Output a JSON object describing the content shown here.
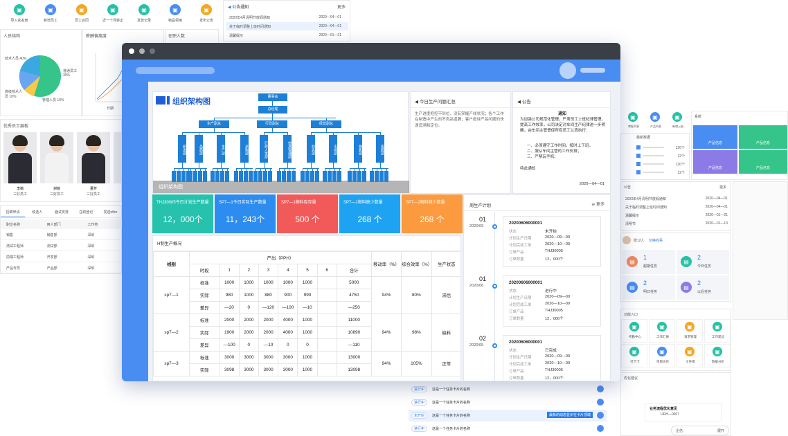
{
  "bg_top_left": {
    "quick_actions": [
      {
        "label": "导入花名册",
        "color": "#26c2a4",
        "icon": "import-icon"
      },
      {
        "label": "新增员工",
        "color": "#4a8df2",
        "icon": "add-user-icon"
      },
      {
        "label": "员工合同",
        "color": "#f5a623",
        "icon": "contract-icon"
      },
      {
        "label": "近一个月转正",
        "color": "#26c2a4",
        "icon": "calendar-icon"
      },
      {
        "label": "发放记录",
        "color": "#26c2a4",
        "icon": "record-icon"
      },
      {
        "label": "物品领用",
        "color": "#4a8df2",
        "icon": "box-icon"
      },
      {
        "label": "发布公告",
        "color": "#f5a623",
        "icon": "announce-icon"
      }
    ],
    "structure_title": "人员结构",
    "pie_labels": [
      "技术人员 40%",
      "普通员工 30%",
      "高级技术人员 10%",
      "管理人员 10%"
    ],
    "salary_title": "薪酬偏离度",
    "line_x_label": "日期",
    "headcount_title": "在职人数",
    "excellent_title": "优秀员工展板",
    "employees": [
      {
        "name": "李萌",
        "role": "三好员工"
      },
      {
        "name": "谢敏",
        "role": "三好员工"
      },
      {
        "name": "董芳",
        "role": "三好员工"
      }
    ],
    "tabs": [
      "招聘申请",
      "候选人",
      "面试安排",
      "在职登记",
      "发送offer"
    ],
    "table_headers": [
      "职位名称",
      "用人部门",
      "工作地"
    ],
    "table_rows": [
      [
        "销售",
        "销售部",
        "深圳"
      ],
      [
        "测试工程师",
        "测试部",
        "深圳"
      ],
      [
        "前端工程师",
        "开发部",
        "深圳"
      ],
      [
        "产品专员",
        "产品部",
        "深圳"
      ]
    ],
    "notice_title": "公告通知",
    "notice_more": "更多",
    "notices": [
      {
        "title": "2020年4月清明节放假通知",
        "date": "2020—04—01"
      },
      {
        "title": "关于临时调整上班时间通知",
        "date": "2020—04—01"
      },
      {
        "title": "温馨提示",
        "date": "2020—01—21"
      }
    ]
  },
  "bg_right": {
    "quick_icons": [
      "审批列表",
      "产品列表",
      "新增上报"
    ],
    "list_title": "最新数据",
    "list_values": [
      "120个",
      "12个",
      "120个",
      "12个"
    ],
    "sys_title": "系统",
    "tiles": [
      "产品信息",
      "产品信息",
      "产品信息",
      "产品信息"
    ],
    "notice_title": "公告",
    "notice_more": "更多",
    "notices": [
      {
        "title": "2020年4月清明节放假通知",
        "date": "2020—04—01"
      },
      {
        "title": "关于临时调整上班时间通知",
        "date": "2020—04—01"
      },
      {
        "title": "温馨提示",
        "date": "2020—01—21"
      },
      {
        "title": "清明节",
        "date": "2020—01—13"
      }
    ],
    "greeting": "张12人",
    "switch_label": "切换商事",
    "tasks": [
      {
        "count": "1",
        "label": "超期任务",
        "color": "#f08a5d"
      },
      {
        "count": "2",
        "label": "今日任务",
        "color": "#26c2a4"
      },
      {
        "count": "2",
        "label": "明日任务",
        "color": "#4a8df2"
      },
      {
        "count": "2",
        "label": "以后任务",
        "color": "#8c7ae6"
      }
    ],
    "entry_title": "功能入口",
    "entries": [
      {
        "label": "考勤中心",
        "color": "#26c2a4"
      },
      {
        "label": "工作汇报",
        "color": "#26c2a4"
      },
      {
        "label": "请求管理",
        "color": "#f5a623"
      },
      {
        "label": "工作建议",
        "color": "#26c2a4"
      },
      {
        "label": "打卡卡",
        "color": "#26c2a4"
      },
      {
        "label": "项目协作",
        "color": "#4a8df2"
      },
      {
        "label": "文件库",
        "color": "#f5a623"
      },
      {
        "label": "数据分析",
        "color": "#26c2a4"
      }
    ],
    "suggest_title": "优化建议",
    "suggest_card_title": "业务流程优化意见",
    "suggest_card_id": "URH—0067",
    "float_btn_left": "企信",
    "float_btn_right": "展开"
  },
  "bg_bottom_tasks": [
    {
      "status": "进行中",
      "text": "这是一个任务卡片的名称"
    },
    {
      "status": "进行中",
      "text": "这是一个任务卡片的名称"
    },
    {
      "status": "未开始",
      "text": "这是一个任务卡片的名称",
      "tag": "最新的动态显示在卡片顶端"
    },
    {
      "status": "进行中",
      "text": "这是一个任务卡片的名称"
    }
  ],
  "main": {
    "org_title": "组织架构图",
    "org_caption": "组织架构图",
    "org_top": [
      "董事会",
      "总经理"
    ],
    "org_mid": [
      "生产副总",
      "行政副总",
      "经营副总"
    ],
    "org_depts": [
      "研发部",
      "品质部",
      "生产部",
      "采购部",
      "行政人事部",
      "信息管理部",
      "财务部",
      "市场部",
      "销售部",
      "客服部"
    ],
    "issue_title": "今日生产问题汇总",
    "issue_text": "生产进度把控不到位，没有掌握产线状况；各个工作在制造中产生的不良品遗漏；客户投诉产品问题的快速追溯和定位。",
    "notice_title": "公告",
    "notice_heading": "通知",
    "notice_body": "为加强公司规范化管理，严肃员工上班纪律管理，提高工作效率，公司决定对车间生产纪律进一步明确，由车间主管督促所有员工认真执行：",
    "notice_items": [
      "一、必须遵守工作时间，按时上下班。",
      "二、服从车间主管的工作安排；",
      "三、严禁玩手机；"
    ],
    "notice_footer": "特此通知",
    "notice_date": "2020—04—01",
    "kpis": [
      {
        "title": "THJ30005今日计划生产数量",
        "value": "12，000个",
        "color": "#27c2ad"
      },
      {
        "title": "SP7—1今日实际生产数量",
        "value": "11，243个",
        "color": "#2d8cf0"
      },
      {
        "title": "SP7—1物料库存量",
        "value": "500 个",
        "color": "#f25a5a"
      },
      {
        "title": "SP7—1物料缺少数量",
        "value": "268 个",
        "color": "#1ea3f2"
      },
      {
        "title": "SP7—1物料缺少数量",
        "value": "268 个",
        "color": "#fb9a3e"
      }
    ],
    "prod_title": "H制生产概况",
    "prod_headers": {
      "line": "线别",
      "output": "产出（PPH）",
      "period": "时段",
      "hours": [
        "1",
        "2",
        "3",
        "4",
        "5",
        "6"
      ],
      "total": "合计",
      "move": "移动率（%）",
      "eff": "综合效率（%）",
      "state": "生产状态"
    },
    "prod_rows": [
      {
        "line": "sp7—1",
        "move": "94%",
        "eff": "80%",
        "state": "滞后",
        "rows": [
          {
            "t": "标准",
            "v": [
              "1000",
              "1000",
              "1000",
              "1000",
              "1000",
              ""
            ],
            "sum": "5000"
          },
          {
            "t": "实际",
            "v": [
              "980",
              "1000",
              "880",
              "900",
              "990",
              ""
            ],
            "sum": "4750"
          },
          {
            "t": "差异",
            "v": [
              "—20",
              "0",
              "—120",
              "—100",
              "—10",
              ""
            ],
            "sum": "—250"
          }
        ]
      },
      {
        "line": "sp7—2",
        "move": "94%",
        "eff": "98%",
        "state": "缺料",
        "rows": [
          {
            "t": "标准",
            "v": [
              "2000",
              "2000",
              "2000",
              "4000",
              "1000",
              ""
            ],
            "sum": "11000"
          },
          {
            "t": "实际",
            "v": [
              "1900",
              "2000",
              "2000",
              "4000",
              "1000",
              ""
            ],
            "sum": "10890"
          },
          {
            "t": "差异",
            "v": [
              "—100",
              "0",
              "—10",
              "0",
              "0",
              ""
            ],
            "sum": "—110"
          }
        ]
      },
      {
        "line": "sp7—3",
        "move": "94%",
        "eff": "105%",
        "state": "正常",
        "rows": [
          {
            "t": "标准",
            "v": [
              "3000",
              "3000",
              "3000",
              "3000",
              "1000",
              ""
            ],
            "sum": "13000"
          },
          {
            "t": "实际",
            "v": [
              "3098",
              "3000",
              "3000",
              "3000",
              "1000",
              ""
            ],
            "sum": "13098"
          }
        ]
      }
    ],
    "plan_title": "周生产计划",
    "plan_more": "更多",
    "plans": [
      {
        "day": "01",
        "month": "2020/09",
        "id": "20200606000001",
        "status_label": "状态",
        "status": "未开始",
        "start_label": "计划生产日期",
        "start": "2020—09—09",
        "end_label": "计划完成工单",
        "end": "2020—10—09",
        "product_label": "订单产品",
        "product": "THJ30005",
        "qty_label": "订单数量",
        "qty": "12，000个"
      },
      {
        "day": "01",
        "month": "2020/06",
        "id": "20200606000001",
        "status_label": "状态",
        "status": "进行中",
        "start_label": "计划生产日期",
        "start": "2020—09—09",
        "end_label": "计划完成工单",
        "end": "2020—10—09",
        "product_label": "订单产品",
        "product": "THJ30005",
        "qty_label": "订单数量",
        "qty": "12，000个"
      },
      {
        "day": "02",
        "month": "2020/05",
        "id": "20200606000001",
        "status_label": "状态",
        "status": "已完成",
        "start_label": "计划生产日期",
        "start": "2020—09—09",
        "end_label": "计划完成工单",
        "end": "2020—10—09",
        "product_label": "订单产品",
        "product": "THJ30005",
        "qty_label": "订单数量",
        "qty": "12，000个"
      }
    ]
  }
}
